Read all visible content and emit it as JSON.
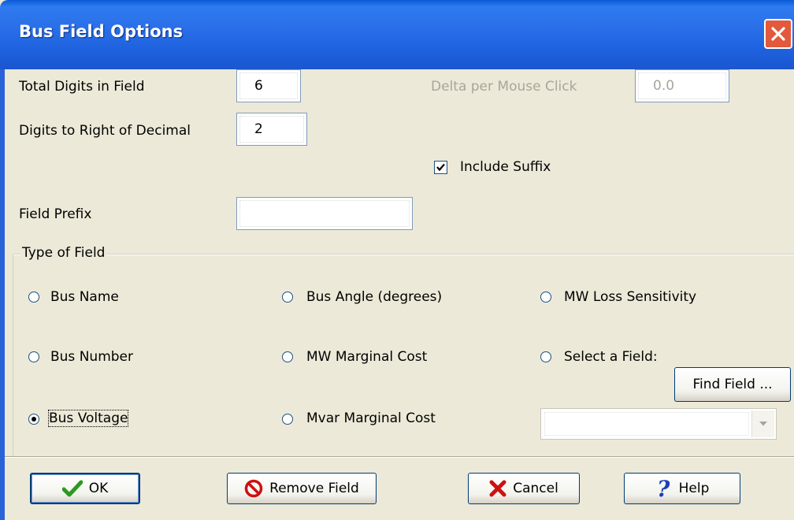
{
  "window": {
    "title": "Bus Field Options"
  },
  "format": {
    "total_digits_label": "Total Digits in Field",
    "total_digits_value": "6",
    "decimal_digits_label": "Digits to Right of Decimal",
    "decimal_digits_value": "2",
    "delta_label": "Delta per Mouse Click",
    "delta_value": "0.0",
    "include_suffix_label": "Include Suffix",
    "include_suffix_checked": true,
    "field_prefix_label": "Field Prefix",
    "field_prefix_value": ""
  },
  "type_of_field": {
    "title": "Type of Field",
    "options": [
      {
        "label": "Bus Name",
        "selected": false
      },
      {
        "label": "Bus Number",
        "selected": false
      },
      {
        "label": "Bus Voltage",
        "selected": true
      },
      {
        "label": "Bus Angle (degrees)",
        "selected": false
      },
      {
        "label": "MW Marginal Cost",
        "selected": false
      },
      {
        "label": "Mvar Marginal Cost",
        "selected": false
      },
      {
        "label": "MW Loss Sensitivity",
        "selected": false
      },
      {
        "label": "Select a Field:",
        "selected": false
      }
    ],
    "find_field_label": "Find Field ...",
    "select_field_value": ""
  },
  "buttons": {
    "ok": "OK",
    "remove_field": "Remove Field",
    "cancel": "Cancel",
    "help": "Help"
  },
  "icons": {
    "ok": "check-icon",
    "remove": "no-entry-icon",
    "cancel": "x-icon",
    "help": "question-icon",
    "close": "close-icon"
  },
  "colors": {
    "titlebar": "#2a6fe8",
    "dialog_bg": "#ece9d8",
    "close_button": "#e3593b",
    "check_green": "#2b9a1f",
    "cancel_red": "#cc1111",
    "help_blue": "#1d3fb8"
  }
}
